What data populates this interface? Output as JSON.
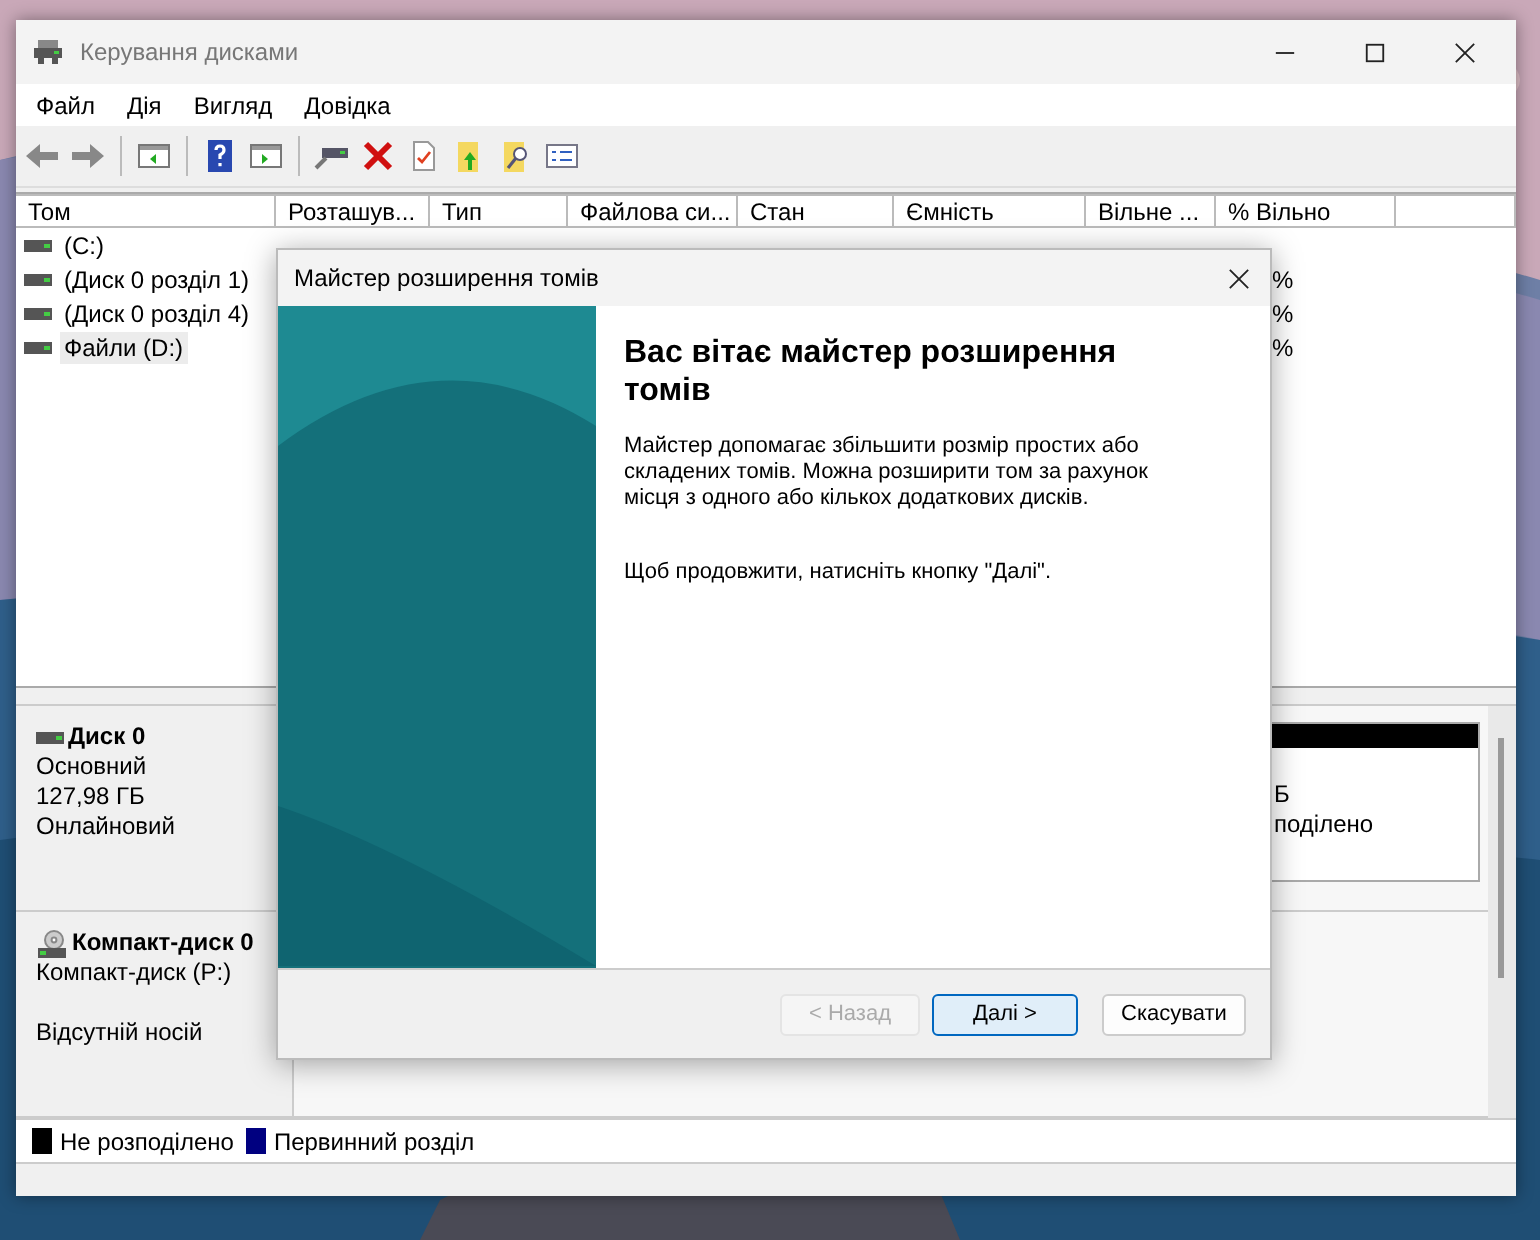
{
  "window": {
    "title": "Керування дисками"
  },
  "menu": [
    "Файл",
    "Дія",
    "Вигляд",
    "Довідка"
  ],
  "volumes": {
    "columns": [
      "Том",
      "Розташув...",
      "Тип",
      "Файлова си...",
      "Стан",
      "Ємність",
      "Вільне ...",
      "% Вільно"
    ],
    "rows": [
      {
        "cells": [
          "(C:)",
          null,
          null,
          null,
          null,
          null,
          null,
          null
        ],
        "selected": false
      },
      {
        "cells": [
          "(Диск 0 розділ 1)",
          null,
          null,
          null,
          null,
          null,
          null,
          "%"
        ],
        "selected": false
      },
      {
        "cells": [
          "(Диск 0 розділ 4)",
          null,
          null,
          null,
          null,
          null,
          null,
          "%"
        ],
        "selected": false
      },
      {
        "cells": [
          "Файли (D:)",
          null,
          null,
          null,
          null,
          null,
          null,
          "%"
        ],
        "selected": true
      }
    ]
  },
  "disks": [
    {
      "kind": "disk",
      "name": "Диск 0",
      "type": "Основний",
      "size": "127,98 ГБ",
      "status": "Онлайновий",
      "partition": {
        "color": "#000000",
        "lines": [
          "Б",
          "поділено"
        ]
      }
    },
    {
      "kind": "cdrom",
      "name": "Компакт-диск 0",
      "type": "Компакт-диск (P:)",
      "status": "Відсутній носій"
    }
  ],
  "legend": [
    {
      "label": "Не розподілено",
      "color": "#000000"
    },
    {
      "label": "Первинний розділ",
      "color": "#000080"
    }
  ],
  "dialog": {
    "title": "Майстер розширення томів",
    "heading": "Вас вітає майстер розширення томів",
    "body": "Майстер допомагає збільшити розмір простих або складених томів. Можна розширити том за рахунок місця з одного або кількох додаткових дисків.",
    "hint": "Щоб продовжити, натисніть кнопку \"Далі\".",
    "buttons": [
      {
        "label": "< Назад",
        "disabled": true,
        "selected": false
      },
      {
        "label": "Далі >",
        "disabled": false,
        "selected": true
      },
      {
        "label": "Скасувати",
        "disabled": false,
        "selected": false
      }
    ]
  }
}
